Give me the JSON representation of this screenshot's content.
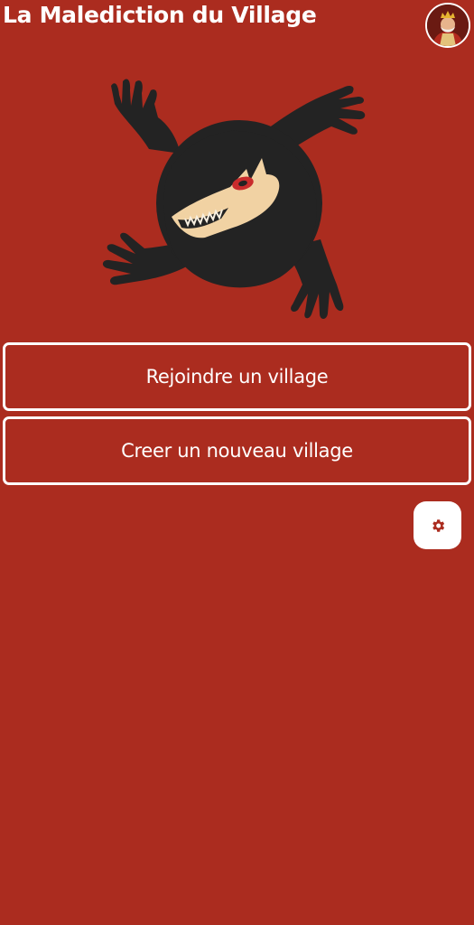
{
  "header": {
    "title": "La Malediction du Village",
    "avatar_icon": "king-avatar-icon"
  },
  "logo": {
    "icon": "werewolf-logo-icon"
  },
  "menu": {
    "join_label": "Rejoindre un village",
    "create_label": "Creer un nouveau village"
  },
  "settings": {
    "icon": "gear-icon"
  },
  "colors": {
    "background": "#ab2c1f",
    "card_border": "#ffffff",
    "logo_fur": "#232323",
    "wolf_head": "#f1d2a3",
    "settings_icon": "#ab2c1f"
  }
}
